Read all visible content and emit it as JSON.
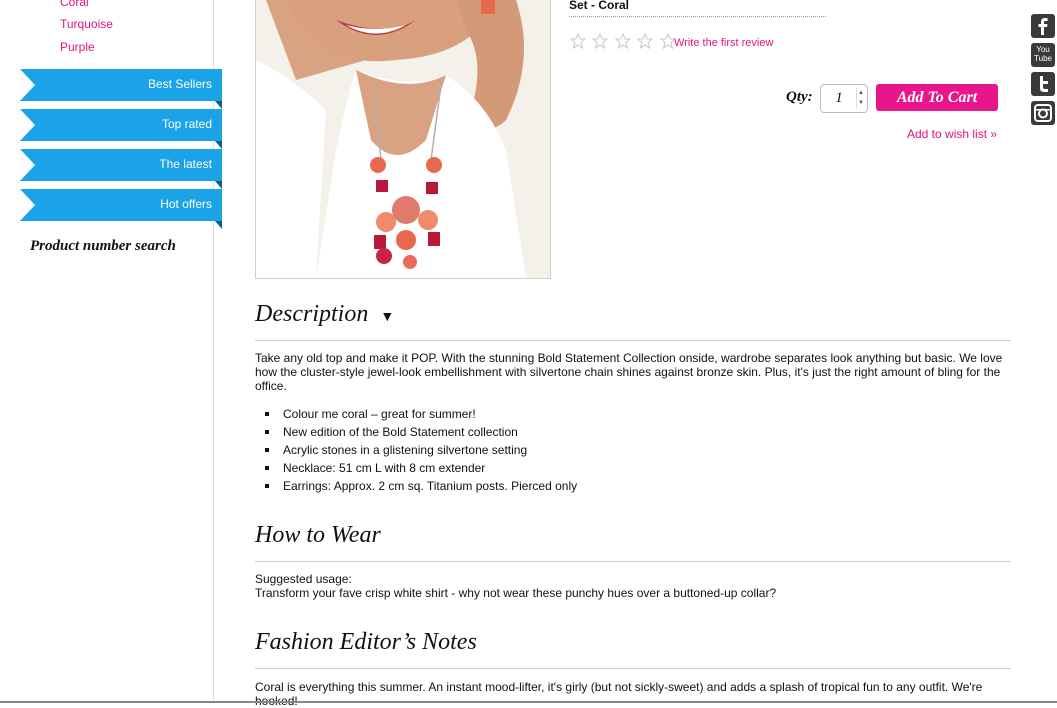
{
  "sidebar": {
    "colors": [
      "Coral",
      "Turquoise",
      "Purple"
    ],
    "ribbons": [
      "Best Sellers",
      "Top rated",
      "The latest",
      "Hot offers"
    ],
    "product_number_search": "Product number search"
  },
  "product": {
    "name": "Set - Coral",
    "rating": 0,
    "review_link": "Write the first review",
    "qty_label": "Qty:",
    "qty_value": "1",
    "add_to_cart": "Add To Cart",
    "wishlist": "Add to wish list »"
  },
  "social": {
    "icons": [
      "facebook-icon",
      "youtube-icon",
      "twitter-icon",
      "instagram-icon"
    ],
    "youtube_text_top": "You",
    "youtube_text_bottom": "Tube"
  },
  "description": {
    "title": "Description",
    "toggle": "▼",
    "text": "Take any old top and make it POP. With the stunning Bold Statement Collection onside, wardrobe separates look anything but basic. We love how the cluster-style jewel-look embellishment with silvertone chain shines against bronze skin. Plus, it's just the right amount of bling for the office.",
    "bullets": [
      "Colour me coral – great for summer!",
      "New edition of the Bold Statement collection",
      "Acrylic stones in a glistening silvertone setting",
      "Necklace: 51 cm L with 8 cm extender",
      "Earrings: Approx. 2 cm sq. Titanium posts. Pierced only"
    ]
  },
  "how_to_wear": {
    "title": "How to Wear",
    "label": "Suggested usage:",
    "text": "Transform your fave crisp white shirt - why not wear these punchy hues over a buttoned-up collar?"
  },
  "editor_notes": {
    "title": "Fashion Editor’s Notes",
    "text": "Coral is everything this summer. An instant mood-lifter, it's girly (but not sickly-sweet) and adds a splash of tropical fun to any outfit. We're hooked!"
  },
  "colors": {
    "accent_pink": "#e8168a",
    "ribbon_blue": "#1aa3e6",
    "social_dark": "#3a3a3a"
  }
}
